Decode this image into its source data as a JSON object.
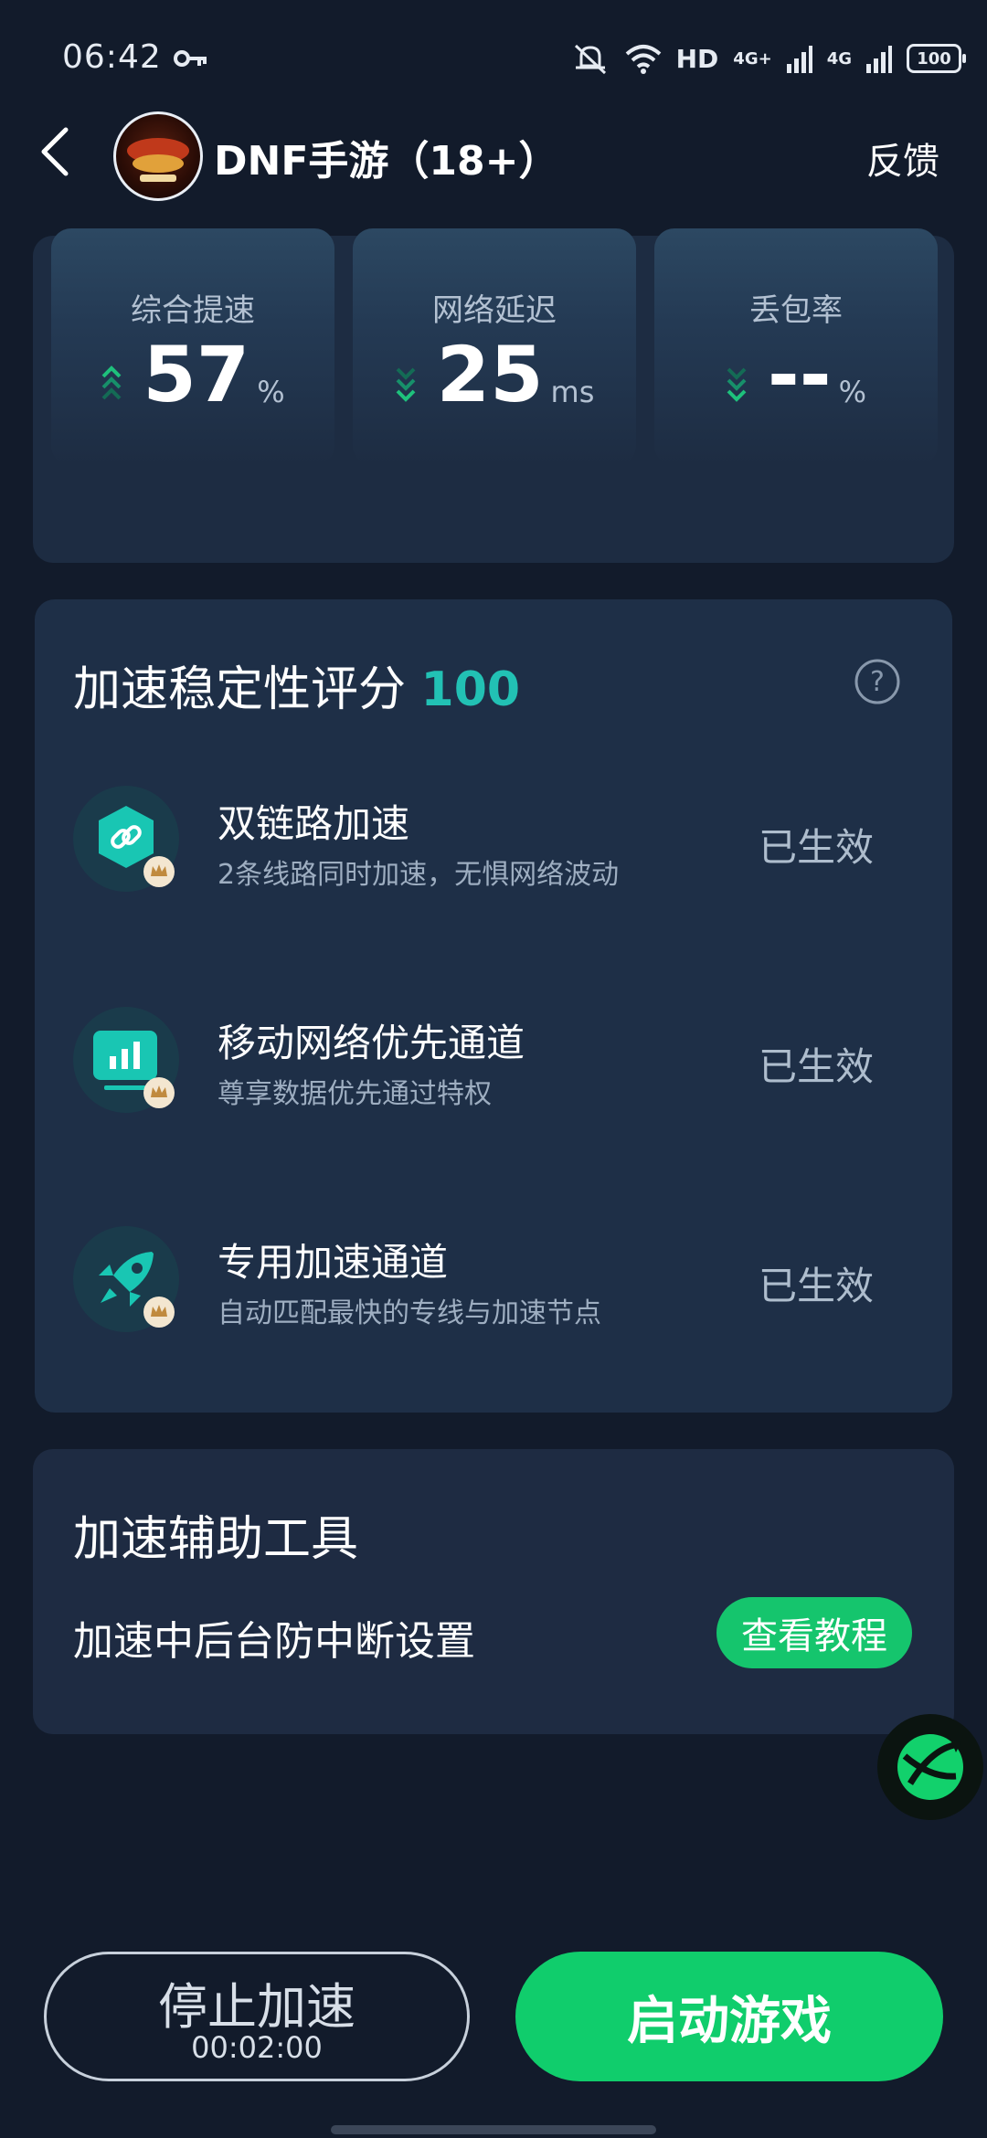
{
  "status_bar": {
    "time": "06:42",
    "hd_text": "HD",
    "net1": "4G+",
    "net2": "4G",
    "battery": "100"
  },
  "header": {
    "game_title": "DNF手游（18+）",
    "feedback_label": "反馈"
  },
  "stats": [
    {
      "label": "综合提速",
      "value": "57",
      "unit": "%",
      "trend": "up"
    },
    {
      "label": "网络延迟",
      "value": "25",
      "unit": "ms",
      "trend": "down"
    },
    {
      "label": "丢包率",
      "value": "--",
      "unit": "%",
      "trend": "down"
    }
  ],
  "stability": {
    "title": "加速稳定性评分",
    "score": "100",
    "features": [
      {
        "title": "双链路加速",
        "desc": "2条线路同时加速，无惧网络波动",
        "status": "已生效",
        "icon": "link-icon"
      },
      {
        "title": "移动网络优先通道",
        "desc": "尊享数据优先通过特权",
        "status": "已生效",
        "icon": "signal-chart-icon"
      },
      {
        "title": "专用加速通道",
        "desc": "自动匹配最快的专线与加速节点",
        "status": "已生效",
        "icon": "rocket-icon"
      }
    ]
  },
  "tools": {
    "title": "加速辅助工具",
    "item_label": "加速中后台防中断设置",
    "tutorial_button": "查看教程"
  },
  "bottom": {
    "stop_label": "停止加速",
    "stop_timer": "00:02:00",
    "launch_label": "启动游戏"
  },
  "colors": {
    "background": "#121b2b",
    "card": "#1e2f47",
    "accent_green": "#10cd6c",
    "score_teal": "#22c1b4"
  }
}
